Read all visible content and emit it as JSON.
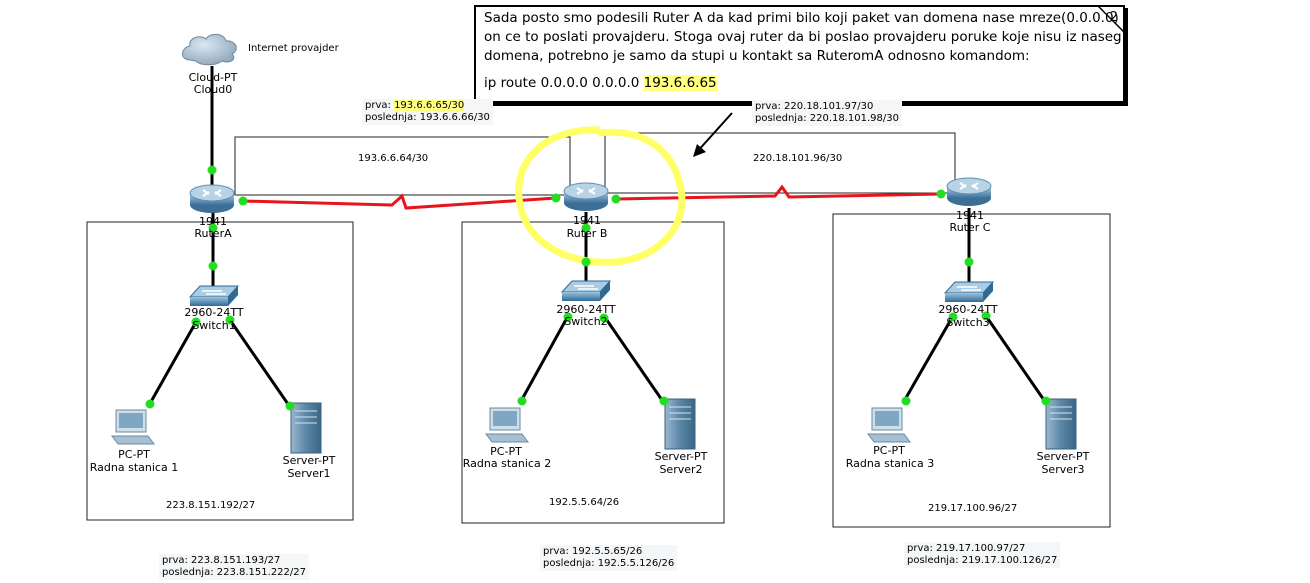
{
  "note": {
    "lines": [
      "Sada posto smo podesili Ruter A da kad primi bilo koji paket van domena nase mreze(0.0.0.0)",
      "on ce to poslati provajderu. Stoga ovaj ruter da bi poslao provajderu poruke koje nisu iz naseg",
      "domena, potrebno je samo da stupi u kontakt sa RuteromA odnosno komandom:"
    ],
    "command_prefix": "ip route 0.0.0.0 0.0.0.0 ",
    "command_hl": "193.6.6.65",
    "number": "2"
  },
  "cloud": {
    "label1": "Cloud-PT",
    "label2": "Cloud0",
    "side_label": "Internet provajder"
  },
  "wan_left": {
    "prva_prefix": "prva: ",
    "prva_hl": "193.6.6.65/30",
    "poslednja": "poslednja: 193.6.6.66/30",
    "network": "193.6.6.64/30"
  },
  "wan_right": {
    "prva": "prva: 220.18.101.97/30",
    "poslednja": "poslednja: 220.18.101.98/30",
    "network": "220.18.101.96/30"
  },
  "routers": [
    {
      "model": "1941",
      "name": "RuterA"
    },
    {
      "model": "1941",
      "name": "Ruter B"
    },
    {
      "model": "1941",
      "name": "Ruter C"
    }
  ],
  "switches": [
    {
      "model": "2960-24TT",
      "name": "Switch1"
    },
    {
      "model": "2960-24TT",
      "name": "Switch2"
    },
    {
      "model": "2960-24TT",
      "name": "Switch3"
    }
  ],
  "pcs": [
    {
      "type": "PC-PT",
      "name": "Radna stanica 1"
    },
    {
      "type": "PC-PT",
      "name": "Radna stanica 2"
    },
    {
      "type": "PC-PT",
      "name": "Radna stanica 3"
    }
  ],
  "servers": [
    {
      "type": "Server-PT",
      "name": "Server1"
    },
    {
      "type": "Server-PT",
      "name": "Server2"
    },
    {
      "type": "Server-PT",
      "name": "Server3"
    }
  ],
  "lans": [
    {
      "network": "223.8.151.192/27",
      "prva": "prva: 223.8.151.193/27",
      "poslednja": "poslednja: 223.8.151.222/27"
    },
    {
      "network": "192.5.5.64/26",
      "prva": "prva: 192.5.5.65/26",
      "poslednja": "poslednja: 192.5.5.126/26"
    },
    {
      "network": "219.17.100.96/27",
      "prva": "prva: 219.17.100.97/27",
      "poslednja": "poslednja: 219.17.100.126/27"
    }
  ],
  "colors": {
    "serial_link": "#e8141c",
    "ethernet_link": "#000000",
    "port_up": "#22dd22",
    "highlight_circle": "#ffff66",
    "highlight_text": "#ffff80",
    "router_body": "#4f87b0",
    "switch_body": "#3f7aa5"
  }
}
